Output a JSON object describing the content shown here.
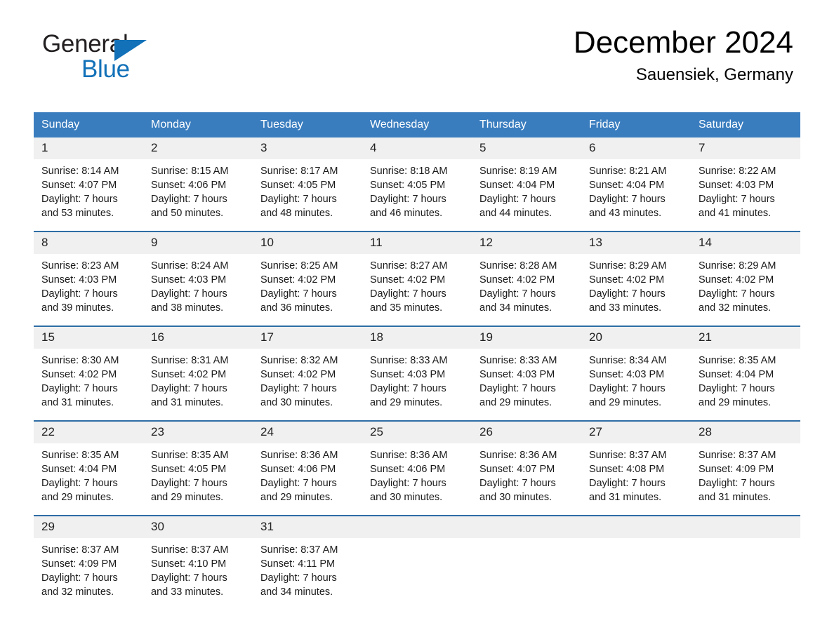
{
  "brand": {
    "name_top": "General",
    "name_bottom": "Blue",
    "accent_color": "#1271b8"
  },
  "header": {
    "title": "December 2024",
    "subtitle": "Sauensiek, Germany"
  },
  "calendar": {
    "header_bg": "#3a7dbf",
    "row_divider_color": "#2e6da4",
    "daynum_bg": "#f0f0f0",
    "weekday_headers": [
      "Sunday",
      "Monday",
      "Tuesday",
      "Wednesday",
      "Thursday",
      "Friday",
      "Saturday"
    ],
    "weeks": [
      [
        {
          "day": "1",
          "sunrise": "Sunrise: 8:14 AM",
          "sunset": "Sunset: 4:07 PM",
          "daylight_line1": "Daylight: 7 hours",
          "daylight_line2": "and 53 minutes."
        },
        {
          "day": "2",
          "sunrise": "Sunrise: 8:15 AM",
          "sunset": "Sunset: 4:06 PM",
          "daylight_line1": "Daylight: 7 hours",
          "daylight_line2": "and 50 minutes."
        },
        {
          "day": "3",
          "sunrise": "Sunrise: 8:17 AM",
          "sunset": "Sunset: 4:05 PM",
          "daylight_line1": "Daylight: 7 hours",
          "daylight_line2": "and 48 minutes."
        },
        {
          "day": "4",
          "sunrise": "Sunrise: 8:18 AM",
          "sunset": "Sunset: 4:05 PM",
          "daylight_line1": "Daylight: 7 hours",
          "daylight_line2": "and 46 minutes."
        },
        {
          "day": "5",
          "sunrise": "Sunrise: 8:19 AM",
          "sunset": "Sunset: 4:04 PM",
          "daylight_line1": "Daylight: 7 hours",
          "daylight_line2": "and 44 minutes."
        },
        {
          "day": "6",
          "sunrise": "Sunrise: 8:21 AM",
          "sunset": "Sunset: 4:04 PM",
          "daylight_line1": "Daylight: 7 hours",
          "daylight_line2": "and 43 minutes."
        },
        {
          "day": "7",
          "sunrise": "Sunrise: 8:22 AM",
          "sunset": "Sunset: 4:03 PM",
          "daylight_line1": "Daylight: 7 hours",
          "daylight_line2": "and 41 minutes."
        }
      ],
      [
        {
          "day": "8",
          "sunrise": "Sunrise: 8:23 AM",
          "sunset": "Sunset: 4:03 PM",
          "daylight_line1": "Daylight: 7 hours",
          "daylight_line2": "and 39 minutes."
        },
        {
          "day": "9",
          "sunrise": "Sunrise: 8:24 AM",
          "sunset": "Sunset: 4:03 PM",
          "daylight_line1": "Daylight: 7 hours",
          "daylight_line2": "and 38 minutes."
        },
        {
          "day": "10",
          "sunrise": "Sunrise: 8:25 AM",
          "sunset": "Sunset: 4:02 PM",
          "daylight_line1": "Daylight: 7 hours",
          "daylight_line2": "and 36 minutes."
        },
        {
          "day": "11",
          "sunrise": "Sunrise: 8:27 AM",
          "sunset": "Sunset: 4:02 PM",
          "daylight_line1": "Daylight: 7 hours",
          "daylight_line2": "and 35 minutes."
        },
        {
          "day": "12",
          "sunrise": "Sunrise: 8:28 AM",
          "sunset": "Sunset: 4:02 PM",
          "daylight_line1": "Daylight: 7 hours",
          "daylight_line2": "and 34 minutes."
        },
        {
          "day": "13",
          "sunrise": "Sunrise: 8:29 AM",
          "sunset": "Sunset: 4:02 PM",
          "daylight_line1": "Daylight: 7 hours",
          "daylight_line2": "and 33 minutes."
        },
        {
          "day": "14",
          "sunrise": "Sunrise: 8:29 AM",
          "sunset": "Sunset: 4:02 PM",
          "daylight_line1": "Daylight: 7 hours",
          "daylight_line2": "and 32 minutes."
        }
      ],
      [
        {
          "day": "15",
          "sunrise": "Sunrise: 8:30 AM",
          "sunset": "Sunset: 4:02 PM",
          "daylight_line1": "Daylight: 7 hours",
          "daylight_line2": "and 31 minutes."
        },
        {
          "day": "16",
          "sunrise": "Sunrise: 8:31 AM",
          "sunset": "Sunset: 4:02 PM",
          "daylight_line1": "Daylight: 7 hours",
          "daylight_line2": "and 31 minutes."
        },
        {
          "day": "17",
          "sunrise": "Sunrise: 8:32 AM",
          "sunset": "Sunset: 4:02 PM",
          "daylight_line1": "Daylight: 7 hours",
          "daylight_line2": "and 30 minutes."
        },
        {
          "day": "18",
          "sunrise": "Sunrise: 8:33 AM",
          "sunset": "Sunset: 4:03 PM",
          "daylight_line1": "Daylight: 7 hours",
          "daylight_line2": "and 29 minutes."
        },
        {
          "day": "19",
          "sunrise": "Sunrise: 8:33 AM",
          "sunset": "Sunset: 4:03 PM",
          "daylight_line1": "Daylight: 7 hours",
          "daylight_line2": "and 29 minutes."
        },
        {
          "day": "20",
          "sunrise": "Sunrise: 8:34 AM",
          "sunset": "Sunset: 4:03 PM",
          "daylight_line1": "Daylight: 7 hours",
          "daylight_line2": "and 29 minutes."
        },
        {
          "day": "21",
          "sunrise": "Sunrise: 8:35 AM",
          "sunset": "Sunset: 4:04 PM",
          "daylight_line1": "Daylight: 7 hours",
          "daylight_line2": "and 29 minutes."
        }
      ],
      [
        {
          "day": "22",
          "sunrise": "Sunrise: 8:35 AM",
          "sunset": "Sunset: 4:04 PM",
          "daylight_line1": "Daylight: 7 hours",
          "daylight_line2": "and 29 minutes."
        },
        {
          "day": "23",
          "sunrise": "Sunrise: 8:35 AM",
          "sunset": "Sunset: 4:05 PM",
          "daylight_line1": "Daylight: 7 hours",
          "daylight_line2": "and 29 minutes."
        },
        {
          "day": "24",
          "sunrise": "Sunrise: 8:36 AM",
          "sunset": "Sunset: 4:06 PM",
          "daylight_line1": "Daylight: 7 hours",
          "daylight_line2": "and 29 minutes."
        },
        {
          "day": "25",
          "sunrise": "Sunrise: 8:36 AM",
          "sunset": "Sunset: 4:06 PM",
          "daylight_line1": "Daylight: 7 hours",
          "daylight_line2": "and 30 minutes."
        },
        {
          "day": "26",
          "sunrise": "Sunrise: 8:36 AM",
          "sunset": "Sunset: 4:07 PM",
          "daylight_line1": "Daylight: 7 hours",
          "daylight_line2": "and 30 minutes."
        },
        {
          "day": "27",
          "sunrise": "Sunrise: 8:37 AM",
          "sunset": "Sunset: 4:08 PM",
          "daylight_line1": "Daylight: 7 hours",
          "daylight_line2": "and 31 minutes."
        },
        {
          "day": "28",
          "sunrise": "Sunrise: 8:37 AM",
          "sunset": "Sunset: 4:09 PM",
          "daylight_line1": "Daylight: 7 hours",
          "daylight_line2": "and 31 minutes."
        }
      ],
      [
        {
          "day": "29",
          "sunrise": "Sunrise: 8:37 AM",
          "sunset": "Sunset: 4:09 PM",
          "daylight_line1": "Daylight: 7 hours",
          "daylight_line2": "and 32 minutes."
        },
        {
          "day": "30",
          "sunrise": "Sunrise: 8:37 AM",
          "sunset": "Sunset: 4:10 PM",
          "daylight_line1": "Daylight: 7 hours",
          "daylight_line2": "and 33 minutes."
        },
        {
          "day": "31",
          "sunrise": "Sunrise: 8:37 AM",
          "sunset": "Sunset: 4:11 PM",
          "daylight_line1": "Daylight: 7 hours",
          "daylight_line2": "and 34 minutes."
        },
        {
          "day": "",
          "sunrise": "",
          "sunset": "",
          "daylight_line1": "",
          "daylight_line2": ""
        },
        {
          "day": "",
          "sunrise": "",
          "sunset": "",
          "daylight_line1": "",
          "daylight_line2": ""
        },
        {
          "day": "",
          "sunrise": "",
          "sunset": "",
          "daylight_line1": "",
          "daylight_line2": ""
        },
        {
          "day": "",
          "sunrise": "",
          "sunset": "",
          "daylight_line1": "",
          "daylight_line2": ""
        }
      ]
    ]
  }
}
